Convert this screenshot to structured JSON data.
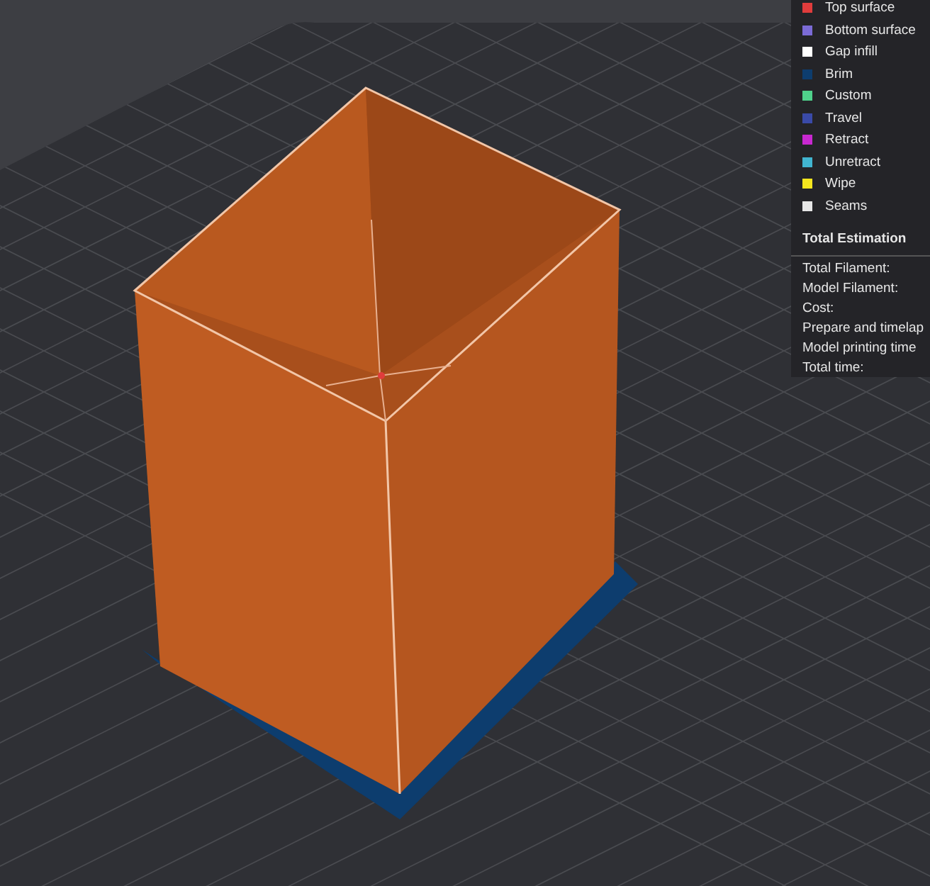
{
  "legend": {
    "items": [
      {
        "label": "Top surface",
        "color": "#e03c3c"
      },
      {
        "label": "Bottom surface",
        "color": "#7b6bd6"
      },
      {
        "label": "Gap infill",
        "color": "#ffffff"
      },
      {
        "label": "Brim",
        "color": "#0d3d6e"
      },
      {
        "label": "Custom",
        "color": "#4fd18b"
      },
      {
        "label": "Travel",
        "color": "#3a4aa8"
      },
      {
        "label": "Retract",
        "color": "#c828d0"
      },
      {
        "label": "Unretract",
        "color": "#41b5d0"
      },
      {
        "label": "Wipe",
        "color": "#f5e61e"
      },
      {
        "label": "Seams",
        "color": "#e6e6e6"
      }
    ]
  },
  "estimation": {
    "title": "Total Estimation",
    "rows": [
      "Total Filament:",
      "Model Filament:",
      "Cost:",
      "Prepare and timelap",
      "Model printing time",
      "Total time:"
    ]
  }
}
